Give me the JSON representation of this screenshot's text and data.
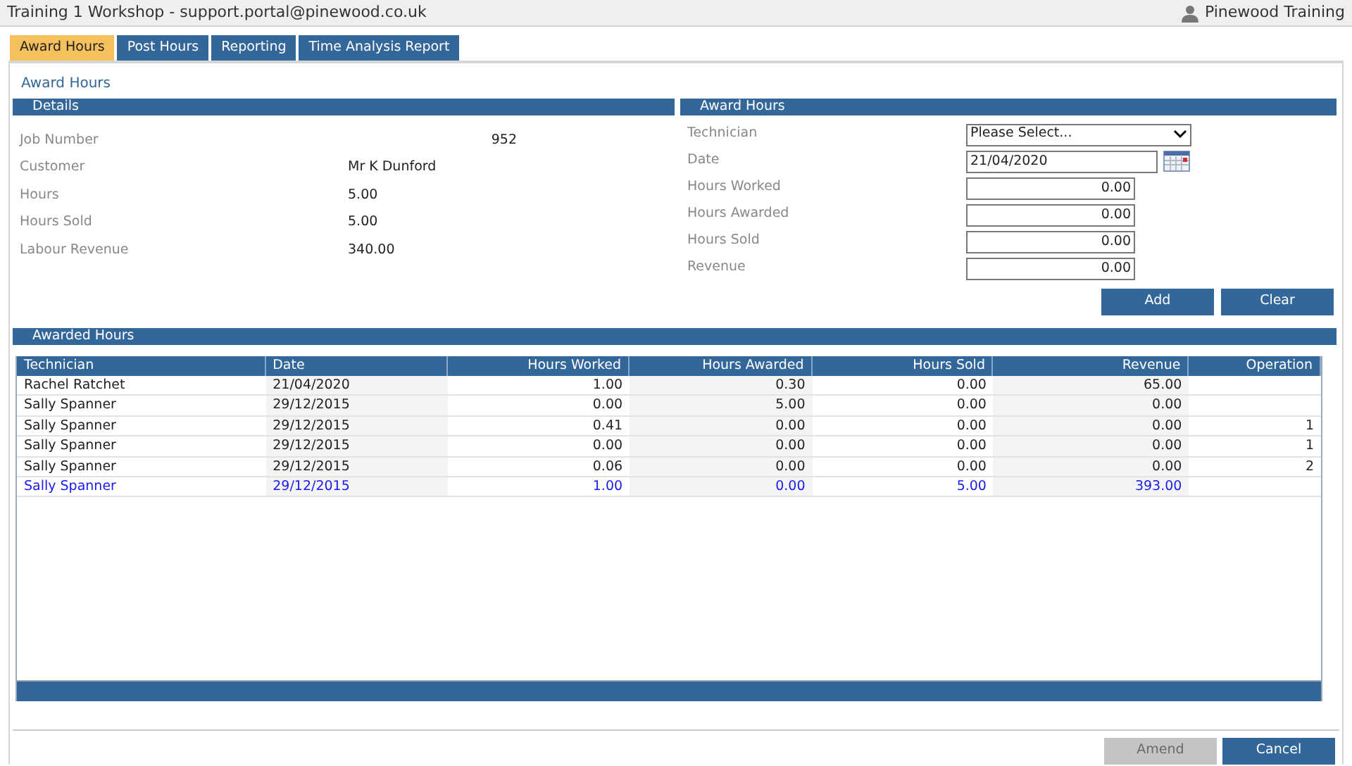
{
  "window": {
    "title": "Training 1 Workshop - support.portal@pinewood.co.uk",
    "user": "Pinewood Training"
  },
  "tabs": [
    {
      "label": "Award Hours",
      "selected": true
    },
    {
      "label": "Post Hours",
      "selected": false
    },
    {
      "label": "Reporting",
      "selected": false
    },
    {
      "label": "Time Analysis Report",
      "selected": false
    }
  ],
  "page_title": "Award Hours",
  "details": {
    "title": "Details",
    "fields": [
      {
        "label": "Job Number",
        "value": "952"
      },
      {
        "label": "Customer",
        "value": "Mr K Dunford"
      },
      {
        "label": "Hours",
        "value": "5.00"
      },
      {
        "label": "Hours Sold",
        "value": "5.00"
      },
      {
        "label": "Labour Revenue",
        "value": "340.00"
      }
    ]
  },
  "award_form": {
    "title": "Award Hours",
    "fields": [
      {
        "kind": "select",
        "label": "Technician",
        "value": "Please Select..."
      },
      {
        "kind": "date",
        "label": "Date",
        "value": "21/04/2020"
      },
      {
        "kind": "number",
        "label": "Hours Worked",
        "value": "0.00"
      },
      {
        "kind": "number",
        "label": "Hours Awarded",
        "value": "0.00"
      },
      {
        "kind": "number",
        "label": "Hours Sold",
        "value": "0.00"
      },
      {
        "kind": "number",
        "label": "Revenue",
        "value": "0.00"
      }
    ],
    "buttons": [
      {
        "label": "Add",
        "disabled": false
      },
      {
        "label": "Clear",
        "disabled": false
      }
    ]
  },
  "awarded_hours": {
    "title": "Awarded Hours",
    "columns": [
      "Technician",
      "Date",
      "Hours Worked",
      "Hours Awarded",
      "Hours Sold",
      "Revenue",
      "Operation"
    ],
    "rows": [
      {
        "kind": "entry",
        "cells": [
          "Rachel Ratchet",
          "21/04/2020",
          "1.00",
          "0.30",
          "0.00",
          "65.00",
          ""
        ]
      },
      {
        "kind": "entry",
        "cells": [
          "Sally Spanner",
          "29/12/2015",
          "0.00",
          "5.00",
          "0.00",
          "0.00",
          ""
        ]
      },
      {
        "kind": "entry",
        "cells": [
          "Sally Spanner",
          "29/12/2015",
          "0.41",
          "0.00",
          "0.00",
          "0.00",
          "1"
        ]
      },
      {
        "kind": "entry",
        "cells": [
          "Sally Spanner",
          "29/12/2015",
          "0.00",
          "0.00",
          "0.00",
          "0.00",
          "1"
        ]
      },
      {
        "kind": "entry",
        "cells": [
          "Sally Spanner",
          "29/12/2015",
          "0.06",
          "0.00",
          "0.00",
          "0.00",
          "2"
        ]
      },
      {
        "kind": "total",
        "cells": [
          "Sally Spanner",
          "29/12/2015",
          "1.00",
          "0.00",
          "5.00",
          "393.00",
          ""
        ]
      }
    ]
  },
  "footer_buttons": [
    {
      "label": "Amend",
      "disabled": true
    },
    {
      "label": "Cancel",
      "disabled": false
    }
  ]
}
